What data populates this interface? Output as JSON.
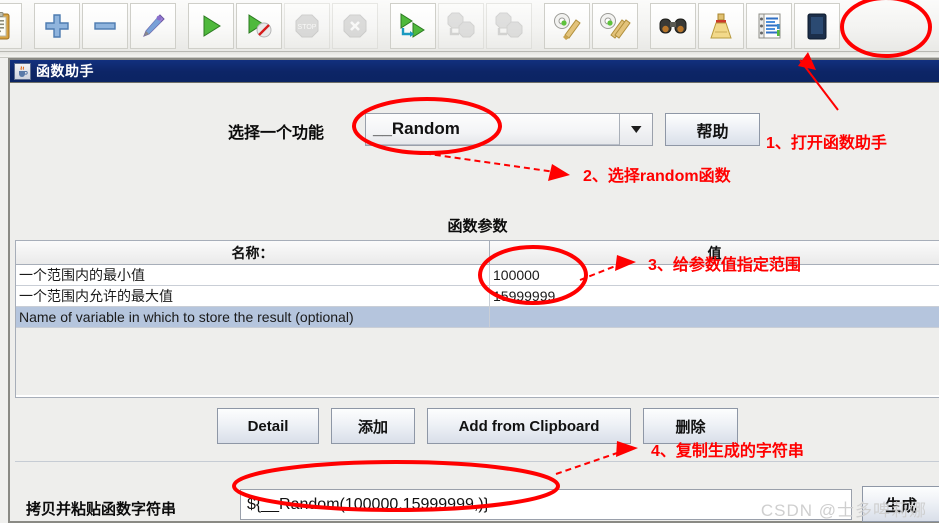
{
  "toolbar": {
    "buttons": [
      {
        "name": "templates-icon",
        "label": "Templates"
      },
      {
        "name": "add-icon",
        "label": "Add"
      },
      {
        "name": "remove-icon",
        "label": "Remove"
      },
      {
        "name": "undo-icon",
        "label": "Undo"
      },
      {
        "name": "start-icon",
        "label": "Start"
      },
      {
        "name": "start-no-timers-icon",
        "label": "Start no pauses"
      },
      {
        "name": "stop-icon",
        "label": "Stop"
      },
      {
        "name": "shutdown-icon",
        "label": "Shutdown"
      },
      {
        "name": "remote-start-all-icon",
        "label": "Remote Start All"
      },
      {
        "name": "remote-stop-all-icon",
        "label": "Remote Stop All"
      },
      {
        "name": "remote-shutdown-all-icon",
        "label": "Remote Shutdown All"
      },
      {
        "name": "clear-icon",
        "label": "Clear"
      },
      {
        "name": "clear-all-icon",
        "label": "Clear All"
      },
      {
        "name": "search-icon",
        "label": "Search"
      },
      {
        "name": "reset-search-icon",
        "label": "Reset Search"
      },
      {
        "name": "function-helper-icon",
        "label": "Function Helper Dialog"
      },
      {
        "name": "heap-icon",
        "label": "Heap"
      }
    ]
  },
  "dialog": {
    "title": "函数助手",
    "choose_label": "选择一个功能",
    "selected_function": "__Random",
    "help_button": "帮助",
    "params_title": "函数参数",
    "table": {
      "headers": [
        "名称：",
        "值"
      ],
      "rows": [
        {
          "name": "一个范围内的最小值",
          "value": "100000",
          "selected": false
        },
        {
          "name": "一个范围内允许的最大值",
          "value": "15999999",
          "selected": false
        },
        {
          "name": "Name of variable in which to store the result (optional)",
          "value": "",
          "selected": true
        }
      ]
    },
    "actions": {
      "detail": "Detail",
      "add": "添加",
      "add_from_clipboard": "Add from Clipboard",
      "delete": "删除"
    },
    "copy_label": "拷贝并粘贴函数字符串",
    "copy_value": "${__Random(100000,15999999,)}",
    "generate_button": "生成"
  },
  "annotations": {
    "accent_color": "#ff0000",
    "items": [
      {
        "id": "step1",
        "text": "1、打开函数助手"
      },
      {
        "id": "step2",
        "text": "2、选择random函数"
      },
      {
        "id": "step3",
        "text": "3、给参数值指定范围"
      },
      {
        "id": "step4",
        "text": "4、复制生成的字符串"
      }
    ]
  },
  "watermark": "CSDN @士多啤莉娜"
}
